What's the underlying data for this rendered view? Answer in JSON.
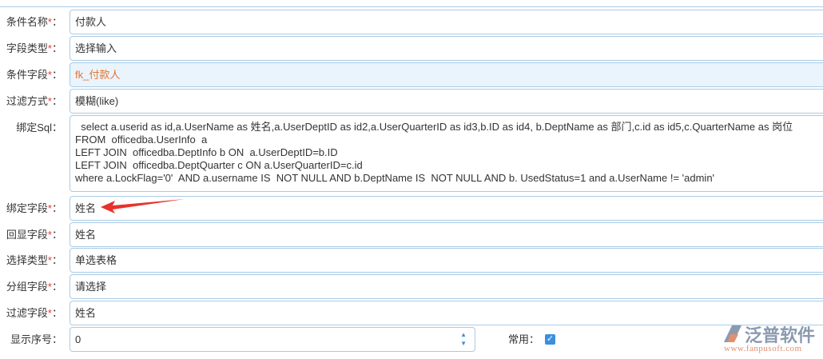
{
  "fields": [
    {
      "label": "条件名称",
      "value": "付款人"
    },
    {
      "label": "字段类型",
      "value": "选择输入"
    },
    {
      "label": "条件字段",
      "value": "fk_付款人"
    },
    {
      "label": "过滤方式",
      "value": "模糊(like)"
    },
    {
      "label": "绑定Sql",
      "value": "  select a.userid as id,a.UserName as 姓名,a.UserDeptID as id2,a.UserQuarterID as id3,b.ID as id4, b.DeptName as 部门,c.id as id5,c.QuarterName as 岗位\nFROM  officedba.UserInfo  a\nLEFT JOIN  officedba.DeptInfo b ON  a.UserDeptID=b.ID\nLEFT JOIN  officedba.DeptQuarter c ON a.UserQuarterID=c.id\nwhere a.LockFlag='0'  AND a.username IS  NOT NULL AND b.DeptName IS  NOT NULL AND b. UsedStatus=1 and a.UserName != 'admin'"
    },
    {
      "label": "绑定字段",
      "value": "姓名"
    },
    {
      "label": "回显字段",
      "value": "姓名"
    },
    {
      "label": "选择类型",
      "value": "单选表格"
    },
    {
      "label": "分组字段",
      "value": "请选择"
    },
    {
      "label": "过滤字段",
      "value": "姓名"
    },
    {
      "label": "显示序号",
      "value": "0"
    }
  ],
  "required_mark": "*",
  "colon": "：",
  "common_label": "常用：",
  "common_checked": true,
  "logo": {
    "name": "泛普软件",
    "url": "www.fanpusoft.com"
  }
}
